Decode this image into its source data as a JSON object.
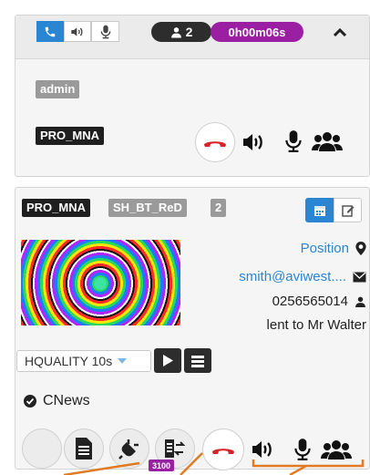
{
  "session": {
    "user_count": "2",
    "timer": "0h00m06s",
    "operator_tag": "admin",
    "unit_name": "PRO_MNA"
  },
  "unit": {
    "unit_tag": "PRO_MNA",
    "device_tag": "SH_BT_ReD",
    "count_tag": "2",
    "position_link": "Position",
    "email": "smith@aviwest....",
    "phone": "0256565014",
    "note": "lent to Mr Walter",
    "profile_value": "HQUALITY 10s",
    "channel": "CNews",
    "ifb_badge": "3100"
  },
  "colors": {
    "accent_blue": "#2a86d2",
    "timer_purple": "#9b1fa3",
    "hangup_red": "#d8232a",
    "annotation_orange": "#e07b24"
  },
  "icons": [
    "phone-icon",
    "speaker-icon",
    "microphone-icon",
    "user-icon",
    "chevron-up-icon",
    "hangup-icon",
    "group-icon",
    "calendar-icon",
    "edit-icon",
    "location-icon",
    "envelope-icon",
    "play-icon",
    "list-icon",
    "check-circle-icon",
    "document-icon",
    "plug-icon",
    "intercom-icon"
  ]
}
